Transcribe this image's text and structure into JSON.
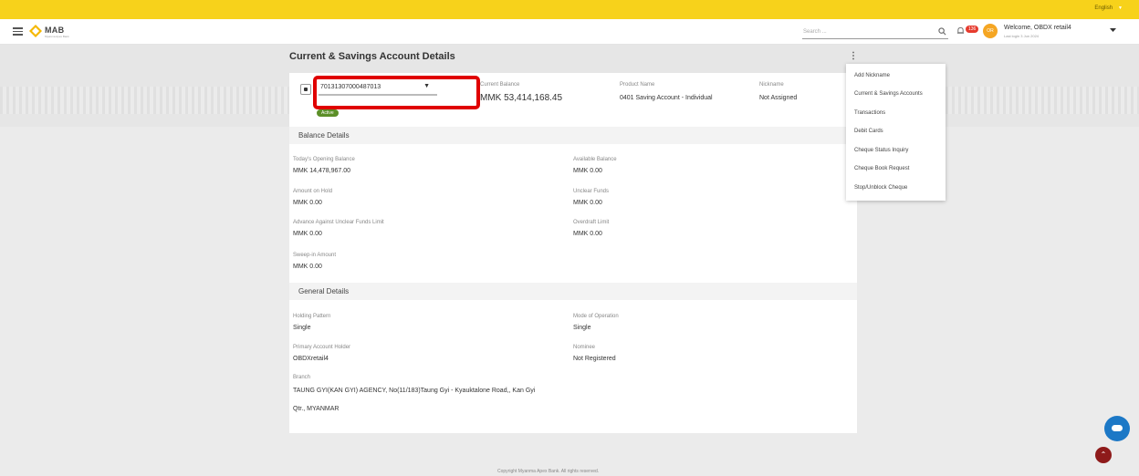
{
  "topbar": {
    "language": "English"
  },
  "header": {
    "brand": "MAB",
    "brand_sub": "Myanma Apex Bank",
    "search_placeholder": "Search ...",
    "notif_count": "136",
    "avatar_initials": "OR",
    "welcome": "Welcome, OBDX retail4",
    "last_login": "Last login 3 Jun 2024"
  },
  "page": {
    "title": "Current & Savings Account Details"
  },
  "account": {
    "number": "70131307000487013",
    "status": "Active",
    "current_balance_label": "Current Balance",
    "current_balance": "MMK 53,414,168.45",
    "product_label": "Product Name",
    "product": "0401 Saving Account - Individual",
    "nickname_label": "Nickname",
    "nickname": "Not Assigned"
  },
  "balance": {
    "title": "Balance Details",
    "opening_label": "Today's Opening Balance",
    "opening": "MMK 14,478,967.00",
    "available_label": "Available Balance",
    "available": "MMK 0.00",
    "hold_label": "Amount on Hold",
    "hold": "MMK 0.00",
    "unclear_label": "Unclear Funds",
    "unclear": "MMK 0.00",
    "advance_label": "Advance Against Unclear Funds Limit",
    "advance": "MMK 0.00",
    "overdraft_label": "Overdraft Limit",
    "overdraft": "MMK 0.00",
    "sweep_label": "Sweep-in Amount",
    "sweep": "MMK 0.00"
  },
  "general": {
    "title": "General Details",
    "holding_label": "Holding Pattern",
    "holding": "Single",
    "mode_label": "Mode of Operation",
    "mode": "Single",
    "primary_label": "Primary Account Holder",
    "primary": "OBDXretail4",
    "nominee_label": "Nominee",
    "nominee": "Not Registered",
    "branch_label": "Branch",
    "branch_line1": "TAUNG GYI(KAN GYI) AGENCY, No(11/183)Taung Gyi - Kyauktalone Road,, Kan Gyi",
    "branch_line2": "Qtr., MYANMAR"
  },
  "menu": {
    "items": [
      "Add Nickname",
      "Current & Savings Accounts",
      "Transactions",
      "Debit Cards",
      "Cheque Status Inquiry",
      "Cheque Book Request",
      "Stop/Unblock Cheque"
    ]
  },
  "footer": {
    "text": "Copyright Myanma Apex Bank. All rights reserved."
  }
}
